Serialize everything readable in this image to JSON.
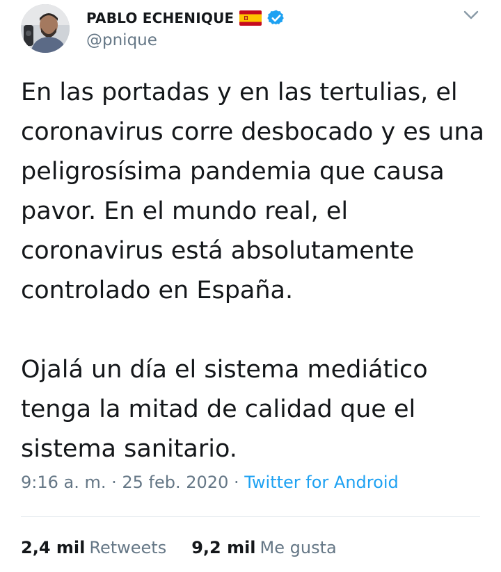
{
  "tweet": {
    "author": {
      "display_name": "PABLO ECHENIQUE",
      "handle": "@pnique",
      "badges": [
        "spain-flag-icon",
        "verified-icon"
      ]
    },
    "paragraphs": [
      "En las portadas y en las tertulias, el coronavirus corre desbocado y es una peligrosísima pandemia que causa pavor. En el mundo real, el coronavirus está absolutamente controlado en España.",
      "Ojalá un día el sistema mediático tenga la mitad de calidad que el sistema sanitario."
    ],
    "meta": {
      "time": "9:16 a. m.",
      "separator": " · ",
      "date": "25 feb. 2020",
      "source": "Twitter for Android"
    },
    "stats": {
      "retweets_count": "2,4 mil",
      "retweets_label": "Retweets",
      "likes_count": "9,2 mil",
      "likes_label": "Me gusta"
    }
  },
  "colors": {
    "text": "#14171a",
    "secondary": "#657786",
    "link": "#1da1f2",
    "verified": "#1da1f2",
    "divider": "#e1e8ed"
  }
}
